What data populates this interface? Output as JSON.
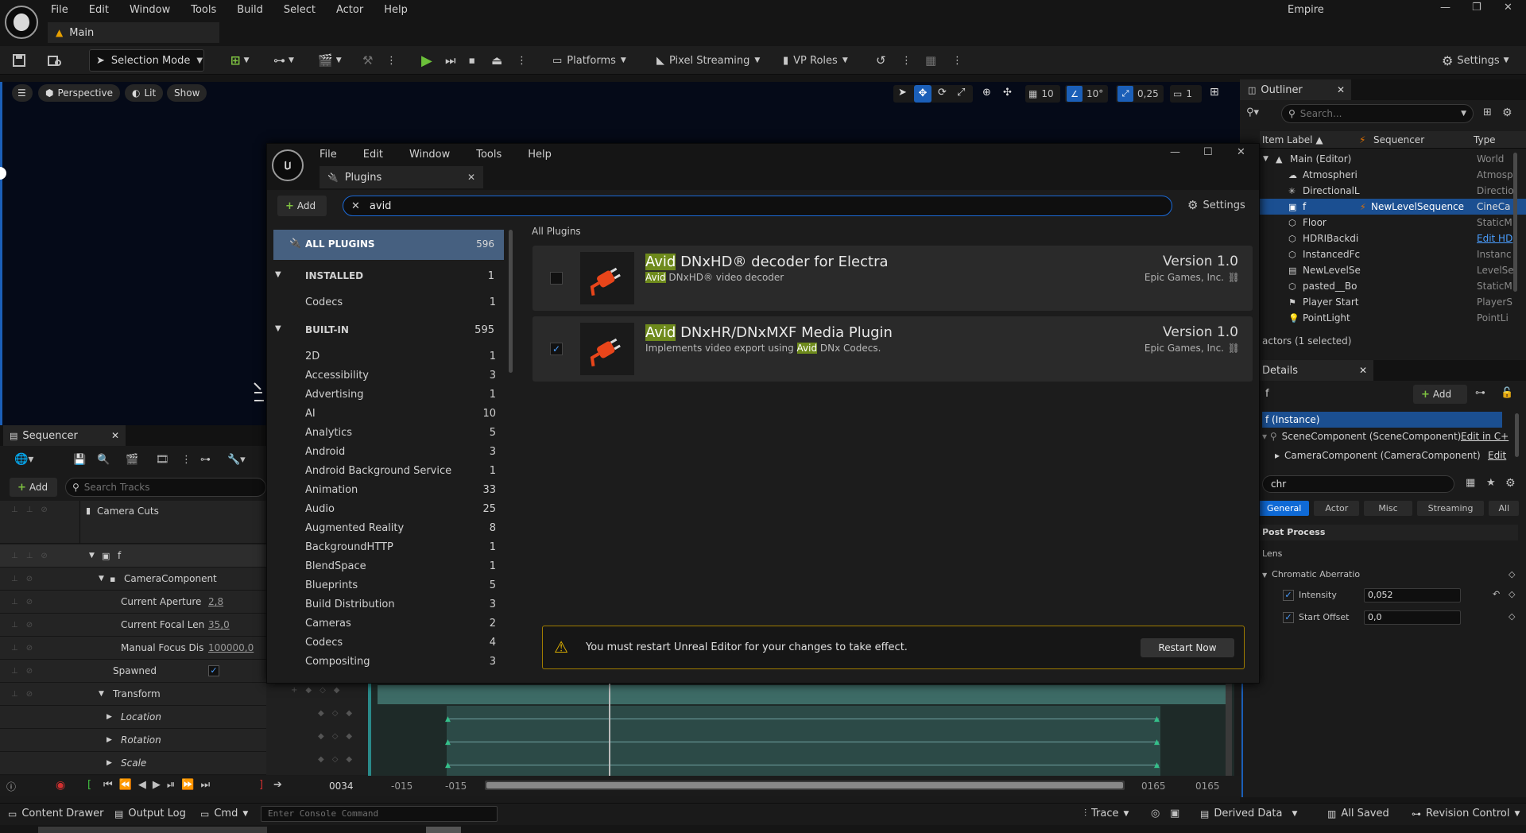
{
  "menu": [
    "File",
    "Edit",
    "Window",
    "Tools",
    "Build",
    "Select",
    "Actor",
    "Help"
  ],
  "main_tab": "Main",
  "project_name": "Empire",
  "toolbar": {
    "selection_mode": "Selection Mode",
    "platforms": "Platforms",
    "pixel_streaming": "Pixel Streaming",
    "vp_roles": "VP Roles",
    "settings": "Settings"
  },
  "viewport": {
    "perspective": "Perspective",
    "lit": "Lit",
    "show": "Show",
    "grid_size": "10",
    "angle_snap": "10°",
    "scale_snap": "0,25",
    "camera_speed": "1"
  },
  "outliner": {
    "title": "Outliner",
    "search_placeholder": "Search...",
    "col_label": "Item Label",
    "col_sequencer": "Sequencer",
    "col_type": "Type",
    "rows": [
      {
        "label": "Main (Editor)",
        "seq": "",
        "type": "World"
      },
      {
        "label": "Atmospheri",
        "seq": "",
        "type": "Atmosp"
      },
      {
        "label": "DirectionalL",
        "seq": "",
        "type": "Directio"
      },
      {
        "label": "f",
        "seq": "NewLevelSequence",
        "type": "CineCa"
      },
      {
        "label": "Floor",
        "seq": "",
        "type": "StaticM"
      },
      {
        "label": "HDRIBackdi",
        "seq": "",
        "type": "Edit HD"
      },
      {
        "label": "InstancedFc",
        "seq": "",
        "type": "Instanc"
      },
      {
        "label": "NewLevelSe",
        "seq": "",
        "type": "LevelSe"
      },
      {
        "label": "pasted__Bo",
        "seq": "",
        "type": "StaticM"
      },
      {
        "label": "Player Start",
        "seq": "",
        "type": "PlayerS"
      },
      {
        "label": "PointLight",
        "seq": "",
        "type": "PointLi"
      }
    ],
    "footer": "actors (1 selected)"
  },
  "details": {
    "title": "Details",
    "add": "Add",
    "object": "f",
    "instance": "f (Instance)",
    "scene_component": "SceneComponent (SceneComponent)",
    "scene_edit": "Edit in C+",
    "camera_component": "CameraComponent (CameraComponent)",
    "camera_edit": "Edit",
    "search_value": "chr",
    "tabs": [
      "General",
      "Actor",
      "Misc",
      "Streaming",
      "All"
    ],
    "section": "Post Process",
    "subsection": "Lens",
    "group": "Chromatic Aberratio",
    "intensity_label": "Intensity",
    "intensity_value": "0,052",
    "start_offset_label": "Start Offset",
    "start_offset_value": "0,0"
  },
  "sequencer": {
    "title": "Sequencer",
    "add": "Add",
    "search_placeholder": "Search Tracks",
    "tracks": {
      "camera_cuts": "Camera Cuts",
      "f": "f",
      "camera_component": "CameraComponent",
      "aperture": "Current Aperture",
      "aperture_value": "2,8",
      "focal": "Current Focal Len",
      "focal_value": "35,0",
      "focus": "Manual Focus Dis",
      "focus_value": "100000,0",
      "spawned": "Spawned",
      "transform": "Transform",
      "location": "Location",
      "rotation": "Rotation",
      "scale": "Scale"
    },
    "frame": "0034",
    "range_start": "-015",
    "range_start2": "-015",
    "range_end": "0165",
    "range_end2": "0165"
  },
  "plugins": {
    "menu": [
      "File",
      "Edit",
      "Window",
      "Tools",
      "Help"
    ],
    "tab": "Plugins",
    "add": "Add",
    "search_value": "avid",
    "settings": "Settings",
    "all_plugins_label": "ALL PLUGINS",
    "all_plugins_count": "596",
    "installed_label": "INSTALLED",
    "installed_count": "1",
    "installed_items": [
      {
        "name": "Codecs",
        "count": "1"
      }
    ],
    "builtin_label": "BUILT-IN",
    "builtin_count": "595",
    "builtin_items": [
      {
        "name": "2D",
        "count": "1"
      },
      {
        "name": "Accessibility",
        "count": "3"
      },
      {
        "name": "Advertising",
        "count": "1"
      },
      {
        "name": "AI",
        "count": "10"
      },
      {
        "name": "Analytics",
        "count": "5"
      },
      {
        "name": "Android",
        "count": "3"
      },
      {
        "name": "Android Background Service",
        "count": "1"
      },
      {
        "name": "Animation",
        "count": "33"
      },
      {
        "name": "Audio",
        "count": "25"
      },
      {
        "name": "Augmented Reality",
        "count": "8"
      },
      {
        "name": "BackgroundHTTP",
        "count": "1"
      },
      {
        "name": "BlendSpace",
        "count": "1"
      },
      {
        "name": "Blueprints",
        "count": "5"
      },
      {
        "name": "Build Distribution",
        "count": "3"
      },
      {
        "name": "Cameras",
        "count": "2"
      },
      {
        "name": "Codecs",
        "count": "4"
      },
      {
        "name": "Compositing",
        "count": "3"
      }
    ],
    "breadcrumb": "All Plugins",
    "cards": [
      {
        "hl": "Avid",
        "title_rest": " DNxHD® decoder for Electra",
        "desc_hl": "Avid",
        "desc_pre": "",
        "desc_rest": " DNxHD® video decoder",
        "version": "Version 1.0",
        "vendor": "Epic Games, Inc.",
        "enabled": false
      },
      {
        "hl": "Avid",
        "title_rest": " DNxHR/DNxMXF Media Plugin",
        "desc_hl": "Avid",
        "desc_pre": "Implements video export using ",
        "desc_rest": " DNx Codecs.",
        "version": "Version 1.0",
        "vendor": "Epic Games, Inc.",
        "enabled": true
      }
    ],
    "restart_message": "You must restart Unreal Editor for your changes to take effect.",
    "restart_button": "Restart Now"
  },
  "statusbar": {
    "content_drawer": "Content Drawer",
    "output_log": "Output Log",
    "cmd": "Cmd",
    "console_placeholder": "Enter Console Command",
    "trace": "Trace",
    "derived_data": "Derived Data",
    "all_saved": "All Saved",
    "revision_control": "Revision Control"
  },
  "colors": {
    "accent": "#1b5fb8",
    "highlight": "#6e8a1c",
    "warning": "#e8b800",
    "selected_row": "#1b4f91"
  }
}
